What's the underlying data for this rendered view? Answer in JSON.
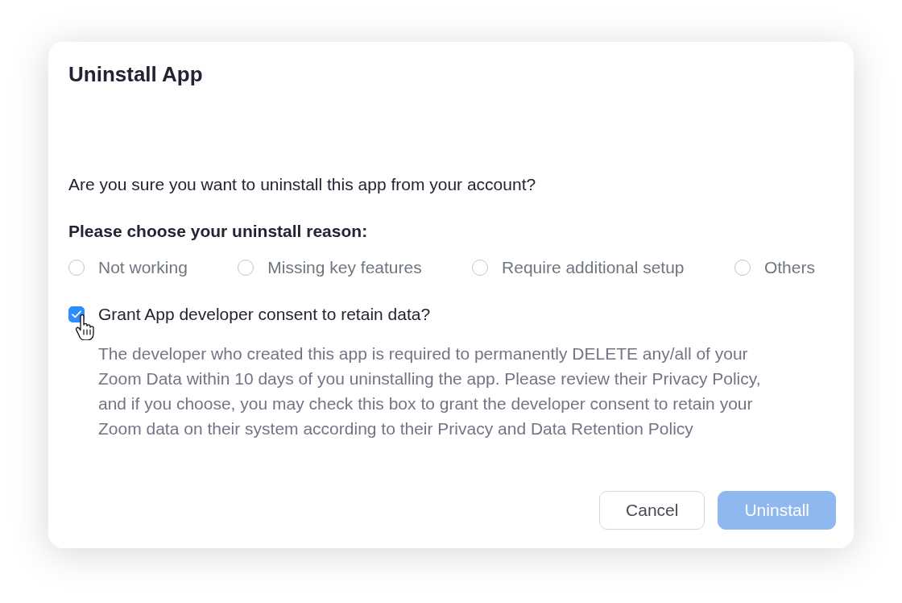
{
  "dialog": {
    "title": "Uninstall App",
    "question": "Are you sure you want to uninstall this app from your account?",
    "reason_label": "Please choose your uninstall reason:",
    "reasons": [
      {
        "label": "Not working",
        "selected": false
      },
      {
        "label": "Missing key features",
        "selected": false
      },
      {
        "label": "Require additional setup",
        "selected": false
      },
      {
        "label": "Others",
        "selected": false
      }
    ],
    "consent": {
      "label": "Grant App developer consent to retain data?",
      "checked": true,
      "description": "The developer who created this app is required to permanently DELETE any/all of your Zoom Data within 10 days of you uninstalling the app. Please review their Privacy Policy, and if you choose, you may check this box to grant the developer consent to retain your Zoom data on their system according to their Privacy and Data Retention Policy"
    },
    "buttons": [
      {
        "label": "Cancel",
        "kind": "secondary",
        "disabled": false
      },
      {
        "label": "Uninstall",
        "kind": "primary",
        "disabled": true
      }
    ]
  }
}
